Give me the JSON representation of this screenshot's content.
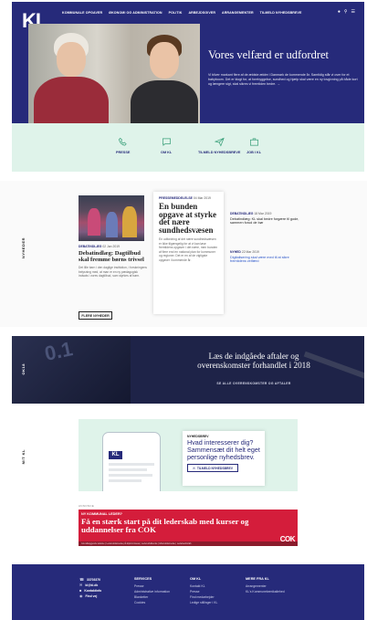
{
  "hero": {
    "logo": "KL",
    "nav": [
      "KOMMUNALE OPGAVER",
      "ØKONOMI OG ADMINISTRATION",
      "POLITIK",
      "ARBEJDSGIVER",
      "ARRANGEMENTER",
      "TILMELD NYHEDSBREVE"
    ],
    "title": "Vores velfærd er udfordret",
    "text": "Vi bliver markant flere af de ældste ældre i Danmark de kommende år. Samtidig står vi over for et babyboom. Det er klogt for, at forebyggelse, sundhed og hjælp skal være en ny lovgivning på både kort og længere sigt, skal sikres vi fremtiden bedre."
  },
  "quick": {
    "items": [
      {
        "icon": "phone-icon",
        "label": "PRESSE"
      },
      {
        "icon": "chat-icon",
        "label": "OM KL"
      },
      {
        "icon": "send-icon",
        "label": "TILMELD NYHEDSBREVE"
      },
      {
        "icon": "briefcase-icon",
        "label": "JOB I KL"
      }
    ]
  },
  "news": {
    "side_label": "NYHEDER",
    "left": {
      "category": "DEBATINDLÆG",
      "date": "02 Jan 2019",
      "title": "Debatindlæg: Dagtilbud skal fremme børns trivsel",
      "text": "Det lille barn i den daglige institution, i forskningens belysning med, at man er en ny pædagogisk indsats i vores dagtilbud, som styrkes af børn."
    },
    "card": {
      "category": "PRESSEMEDDELELSE",
      "date": "04 Mar 2019",
      "title": "En bunden opgave at styrke det nære sundhedsvæsen",
      "text": "En udfordring af det nære sundhedsvæsen er ikke tilgængelig for at vi kan løse fremtidens opgaver i det nære, men bunden af flere end en national plan for kommuner og regioner. Det er en af de vigtigste opgaver i kommende år."
    },
    "right": [
      {
        "category": "DEBATINDLÆG",
        "date": "18 Mar 2019",
        "title": "Debatindlæg: KL skal bedre forgære til gode, sammen forud de bør",
        "link": false
      },
      {
        "category": "NYHED",
        "date": "22 Mar 2019",
        "title": "Digitalisering skal være med til at sikre fremtidens velfærd",
        "link": true
      }
    ],
    "more_button": "FLERE NYHEDER"
  },
  "agreements": {
    "side_label": "OK18",
    "title": "Læs de indgåede aftaler og overenskomster forhandlet i 2018",
    "link": "SE ALLE OVERENSKOMSTER OG AFTALER"
  },
  "newsletter": {
    "side_label": "MIT KL",
    "phone_logo": "KL",
    "kicker": "NYHEDSBREV",
    "title": "Hvad interesserer dig? Sammensæt dit helt eget personlige nyhedsbrev.",
    "button": "TILMELD NYHEDSBREV"
  },
  "banner": {
    "ad_label": "ANNONCE",
    "kicker": "NY KOMMUNAL LEDER?",
    "title": "Få en stærk start på dit lederskab med kurser og uddannelser fra COK",
    "logo": "COK",
    "strip": "Grundlæggende ledelse | Lederuddannelse på diplomniveau | Lederudviklende | Efteruddannelse | Ledelsesforløb"
  },
  "footer": {
    "contact": [
      {
        "icon": "phone-icon",
        "text": "33703370"
      },
      {
        "icon": "mail-icon",
        "text": "kl@kl.dk"
      },
      {
        "icon": "contact-icon",
        "text": "Kontaktinfo"
      },
      {
        "icon": "map-pin-icon",
        "text": "Find vej"
      }
    ],
    "cols": [
      {
        "heading": "SERVICES",
        "items": [
          "Presse",
          "Administrative information",
          "Blanketter",
          "Cookies"
        ]
      },
      {
        "heading": "OM KL",
        "items": [
          "Kontakt KL",
          "Presse",
          "Find medarbejder",
          "Ledige stillinger i KL"
        ]
      },
      {
        "heading": "MERE FRA KL",
        "items": [
          "Arrangementer",
          "KL's Kommunekemikaliehed"
        ]
      }
    ]
  },
  "colors": {
    "primary": "#262a7a",
    "mint": "#dff3ea",
    "banner": "#d41d3b",
    "link": "#2a55c8"
  }
}
